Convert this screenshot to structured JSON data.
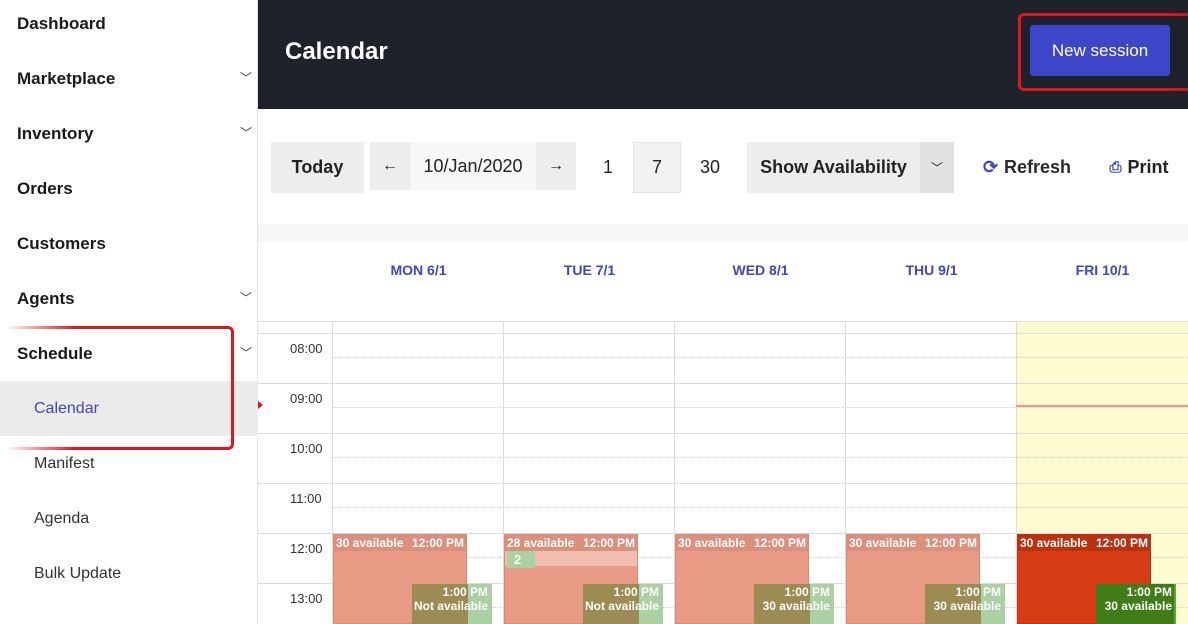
{
  "sidebar": {
    "items": [
      {
        "label": "Dashboard",
        "has_children": false
      },
      {
        "label": "Marketplace",
        "has_children": true
      },
      {
        "label": "Inventory",
        "has_children": true
      },
      {
        "label": "Orders",
        "has_children": false
      },
      {
        "label": "Customers",
        "has_children": false
      },
      {
        "label": "Agents",
        "has_children": true
      },
      {
        "label": "Schedule",
        "has_children": true
      }
    ],
    "sub_items": [
      {
        "label": "Calendar",
        "active": true
      },
      {
        "label": "Manifest",
        "active": false
      },
      {
        "label": "Agenda",
        "active": false
      },
      {
        "label": "Bulk Update",
        "active": false
      }
    ],
    "chevron_icon": "chevron-down-icon"
  },
  "header": {
    "title": "Calendar",
    "new_session_label": "New session",
    "accent_color": "#3d46c8"
  },
  "toolbar": {
    "today_label": "Today",
    "prev_icon": "arrow-left-icon",
    "prev_glyph": "←",
    "date_value": "10/Jan/2020",
    "next_icon": "arrow-right-icon",
    "next_glyph": "→",
    "view_1": "1",
    "view_7": "7",
    "view_30": "30",
    "selected_view": "7",
    "availability_label": "Show Availability",
    "refresh_label": "Refresh",
    "print_label": "Print"
  },
  "calendar": {
    "days": [
      "MON 6/1",
      "TUE 7/1",
      "WED 8/1",
      "THU 9/1",
      "FRI 10/1"
    ],
    "times": [
      "08:00",
      "09:00",
      "10:00",
      "11:00",
      "12:00",
      "13:00"
    ],
    "events": [
      {
        "availability": "30 available",
        "time": "12:00 PM",
        "sub_time": "1:00 PM",
        "sub_status": "Not available"
      },
      {
        "availability": "28 available",
        "time": "12:00 PM",
        "badge": "2",
        "sub_time": "1:00 PM",
        "sub_status": "Not available"
      },
      {
        "availability": "30 available",
        "time": "12:00 PM",
        "sub_time": "1:00 PM",
        "sub_status": "30 available"
      },
      {
        "availability": "30 available",
        "time": "12:00 PM",
        "sub_time": "1:00 PM",
        "sub_status": "30 available"
      },
      {
        "availability": "30 available",
        "time": "12:00 PM",
        "sub_time": "1:00 PM",
        "sub_status": "30 available"
      }
    ],
    "today_column_color": "#fdfbd0"
  }
}
